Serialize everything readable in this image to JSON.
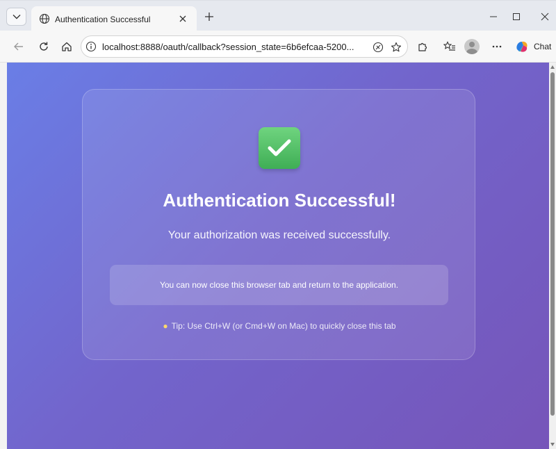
{
  "browser": {
    "tab": {
      "title": "Authentication Successful"
    },
    "address_bar": {
      "url": "localhost:8888/oauth/callback?session_state=6b6efcaa-5200..."
    },
    "chat_label": "Chat"
  },
  "page": {
    "check_icon": "check-mark-icon",
    "headline": "Authentication Successful!",
    "subtitle": "Your authorization was received successfully.",
    "notice": "You can now close this browser tab and return to the application.",
    "tip": "Tip: Use Ctrl+W (or Cmd+W on Mac) to quickly close this tab",
    "colors": {
      "gradient_start": "#6a7ee6",
      "gradient_end": "#7655b9",
      "check_green": "#4cbc61"
    }
  }
}
